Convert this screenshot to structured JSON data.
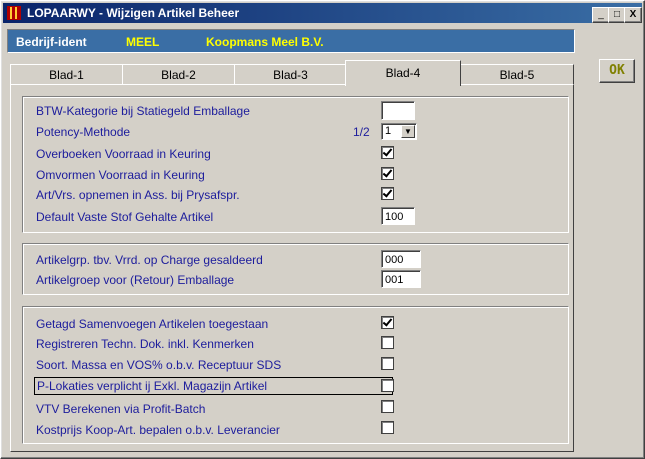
{
  "window": {
    "title": "LOPAARWY - Wijzigen Artikel Beheer",
    "minimize_glyph": "_",
    "maximize_glyph": "□",
    "close_glyph": "X"
  },
  "ident": {
    "label": "Bedrijf-ident",
    "code": "MEEL",
    "name": "Koopmans Meel B.V."
  },
  "ok_label": "OK",
  "tabs": [
    {
      "label": "Blad-1"
    },
    {
      "label": "Blad-2"
    },
    {
      "label": "Blad-3"
    },
    {
      "label": "Blad-4",
      "active": true
    },
    {
      "label": "Blad-5"
    }
  ],
  "group1": {
    "btw_label": "BTW-Kategorie bij Statiegeld Emballage",
    "btw_value": "",
    "potency_label": "Potency-Methode",
    "potency_hint": "1/2",
    "potency_value": "1",
    "overboeken_label": "Overboeken Voorraad in Keuring",
    "overboeken_checked": true,
    "omvormen_label": "Omvormen Voorraad in Keuring",
    "omvormen_checked": true,
    "artvrs_label": "Art/Vrs. opnemen in Ass. bij Prysafspr.",
    "artvrs_checked": true,
    "vastestof_label": "Default Vaste Stof Gehalte Artikel",
    "vastestof_value": "100"
  },
  "group2": {
    "charge_label": "Artikelgrp. tbv. Vrrd. op Charge gesaldeerd",
    "charge_value": "000",
    "retour_label": "Artikelgroep voor (Retour) Emballage",
    "retour_value": "001"
  },
  "group3": {
    "samenvoegen_label": "Getagd Samenvoegen Artikelen toegestaan",
    "samenvoegen_checked": true,
    "techn_label": "Registreren Techn. Dok. inkl. Kenmerken",
    "techn_checked": false,
    "soort_label": "Soort. Massa en VOS% o.b.v. Receptuur SDS",
    "soort_checked": false,
    "plokaties_label": "P-Lokaties verplicht ij Exkl. Magazijn Artikel",
    "plokaties_checked": false,
    "vtv_label": "VTV Berekenen via Profit-Batch",
    "vtv_checked": false,
    "kostprijs_label": "Kostprijs Koop-Art. bepalen o.b.v. Leverancier",
    "kostprijs_checked": false
  }
}
